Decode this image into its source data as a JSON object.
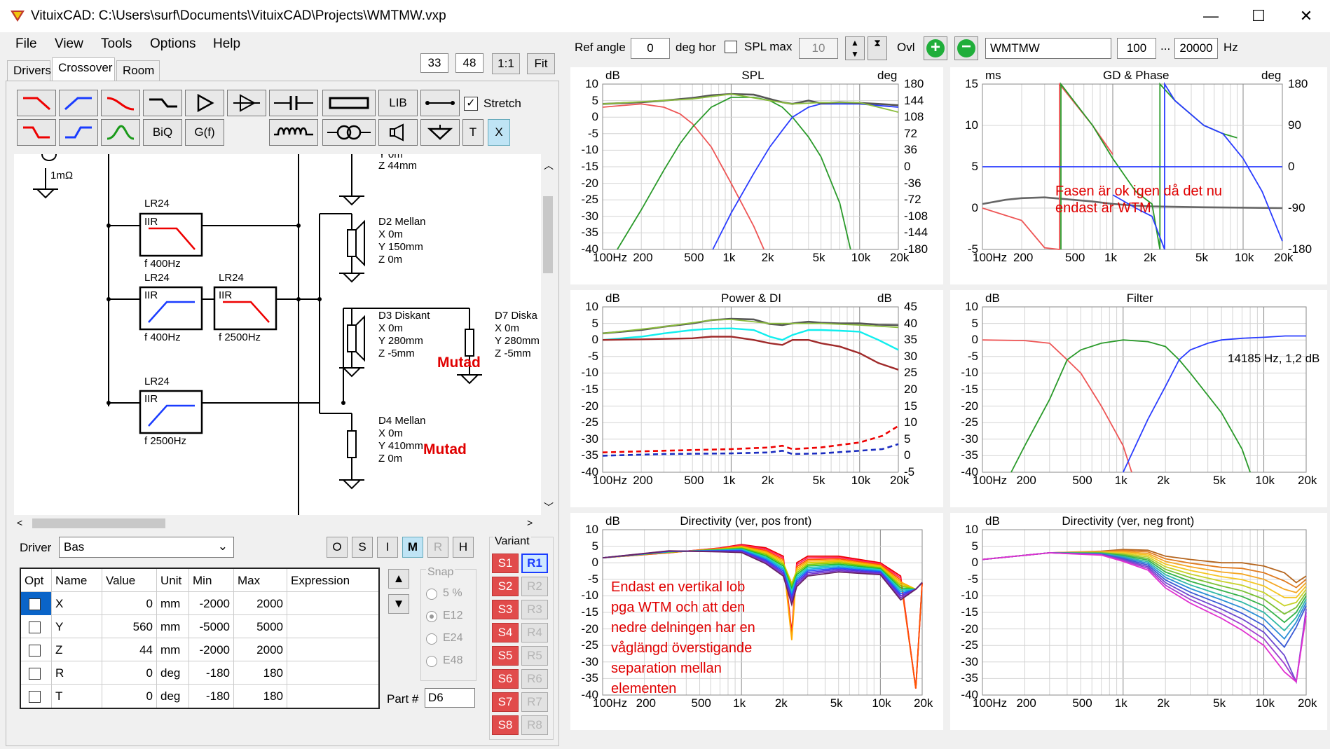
{
  "window": {
    "title": "VituixCAD: C:\\Users\\surf\\Documents\\VituixCAD\\Projects\\WMTMW.vxp",
    "minimize": "—",
    "maximize": "☐",
    "close": "✕"
  },
  "menu": [
    "File",
    "View",
    "Tools",
    "Options",
    "Help"
  ],
  "tabs": [
    "Drivers",
    "Crossover",
    "Room"
  ],
  "zoom": {
    "val1": "33",
    "val2": "48",
    "one_to_one": "1:1",
    "fit": "Fit"
  },
  "toolbar": {
    "lib": "LIB",
    "stretch_label": "Stretch",
    "biq": "BiQ",
    "gf": "G(f)",
    "t": "T",
    "x": "X"
  },
  "top_controls": {
    "ref_angle_label": "Ref angle",
    "ref_angle_value": "0",
    "deg_hor": "deg hor",
    "spl_max_label": "SPL max",
    "spl_max_value": "10",
    "ovl": "Ovl",
    "name_value": "WMTMW",
    "f_low": "100",
    "ellipsis": "...",
    "f_high": "20000",
    "hz": "Hz"
  },
  "schematic": {
    "resistor_label": "1mΩ",
    "filters": [
      {
        "name": "LR24",
        "type": "IIR",
        "freq": "f   400Hz"
      },
      {
        "name": "LR24",
        "type": "IIR",
        "freq": "f   400Hz"
      },
      {
        "name": "LR24",
        "type": "IIR",
        "freq": "f   2500Hz"
      },
      {
        "name": "LR24",
        "type": "IIR",
        "freq": "f   2500Hz"
      }
    ],
    "top_driver_cut": [
      "Y 0m",
      "Z 44mm"
    ],
    "drivers": [
      {
        "name": "D2 Mellan",
        "x": "X 0m",
        "y": "Y 150mm",
        "z": "Z 0m"
      },
      {
        "name": "D3 Diskant",
        "x": "X 0m",
        "y": "Y 280mm",
        "z": "Z -5mm"
      },
      {
        "name": "D7 Diska",
        "x": "X 0m",
        "y": "Y 280mm",
        "z": "Z -5mm"
      },
      {
        "name": "D4 Mellan",
        "x": "X 0m",
        "y": "Y 410mm",
        "z": "Z 0m"
      }
    ],
    "mutad1": "Mutad",
    "mutad2": "Mutad"
  },
  "driver_panel": {
    "driver_label": "Driver",
    "driver_value": "Bas",
    "mode_buttons": [
      "O",
      "S",
      "I",
      "M",
      "R",
      "H"
    ],
    "headers": [
      "Opt",
      "Name",
      "Value",
      "Unit",
      "Min",
      "Max",
      "Expression"
    ],
    "rows": [
      {
        "name": "X",
        "value": "0",
        "unit": "mm",
        "min": "-2000",
        "max": "2000",
        "expr": ""
      },
      {
        "name": "Y",
        "value": "560",
        "unit": "mm",
        "min": "-5000",
        "max": "5000",
        "expr": ""
      },
      {
        "name": "Z",
        "value": "44",
        "unit": "mm",
        "min": "-2000",
        "max": "2000",
        "expr": ""
      },
      {
        "name": "R",
        "value": "0",
        "unit": "deg",
        "min": "-180",
        "max": "180",
        "expr": ""
      },
      {
        "name": "T",
        "value": "0",
        "unit": "deg",
        "min": "-180",
        "max": "180",
        "expr": ""
      }
    ],
    "snap_label": "Snap",
    "snap_options": [
      "5 %",
      "E12",
      "E24",
      "E48"
    ],
    "part_label": "Part #",
    "part_value": "D6",
    "variant_label": "Variant",
    "variants_s": [
      "S1",
      "S2",
      "S3",
      "S4",
      "S5",
      "S6",
      "S7",
      "S8"
    ],
    "variants_r": [
      "R1",
      "R2",
      "R3",
      "R4",
      "R5",
      "R6",
      "R7",
      "R8"
    ]
  },
  "x_ticks": [
    "100Hz",
    "200",
    "500",
    "1k",
    "2k",
    "5k",
    "10k",
    "20k"
  ],
  "plots": {
    "spl": {
      "title": "SPL",
      "left_unit": "dB",
      "right_unit": "deg",
      "left_ticks": [
        "10",
        "5",
        "0",
        "-5",
        "-10",
        "-15",
        "-20",
        "-25",
        "-30",
        "-35",
        "-40"
      ],
      "right_ticks": [
        "180",
        "144",
        "108",
        "72",
        "36",
        "0",
        "-36",
        "-72",
        "-108",
        "-144",
        "-180"
      ]
    },
    "gd": {
      "title": "GD & Phase",
      "left_unit": "ms",
      "right_unit": "deg",
      "left_ticks": [
        "15",
        "10",
        "5",
        "0",
        "-5"
      ],
      "right_ticks": [
        "180",
        "90",
        "0",
        "-90",
        "-180"
      ],
      "note1": "Fasen är ok igen då det nu",
      "note2": "endast är WTM"
    },
    "power": {
      "title": "Power & DI",
      "left_unit": "dB",
      "right_unit": "dB",
      "left_ticks": [
        "10",
        "5",
        "0",
        "-5",
        "-10",
        "-15",
        "-20",
        "-25",
        "-30",
        "-35",
        "-40"
      ],
      "right_ticks": [
        "45",
        "40",
        "35",
        "30",
        "25",
        "20",
        "15",
        "10",
        "5",
        "0",
        "-5"
      ]
    },
    "filter": {
      "title": "Filter",
      "left_unit": "dB",
      "left_ticks": [
        "10",
        "5",
        "0",
        "-5",
        "-10",
        "-15",
        "-20",
        "-25",
        "-30",
        "-35",
        "-40"
      ],
      "readout": "14185 Hz, 1,2 dB"
    },
    "dirpos": {
      "title": "Directivity (ver, pos front)",
      "left_unit": "dB",
      "left_ticks": [
        "10",
        "5",
        "0",
        "-5",
        "-10",
        "-15",
        "-20",
        "-25",
        "-30",
        "-35",
        "-40"
      ],
      "note": [
        "Endast en vertikal lob",
        "pga WTM och att den",
        "nedre delningen har en",
        "våglängd överstigande",
        "separation mellan",
        "elementen"
      ]
    },
    "dirneg": {
      "title": "Directivity (ver, neg front)",
      "left_unit": "dB",
      "left_ticks": [
        "10",
        "5",
        "0",
        "-5",
        "-10",
        "-15",
        "-20",
        "-25",
        "-30",
        "-35",
        "-40"
      ]
    }
  }
}
